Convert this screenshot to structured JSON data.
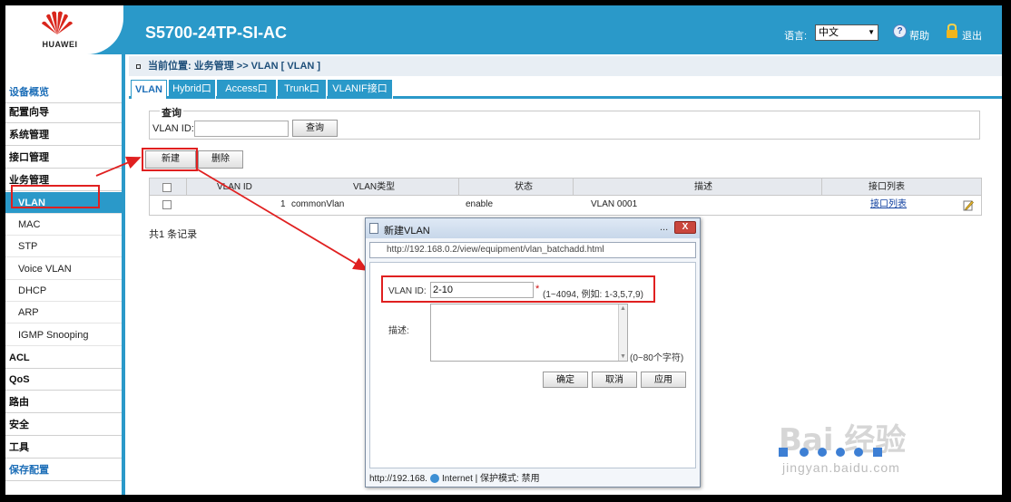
{
  "header": {
    "logo_text": "HUAWEI",
    "device_title": "S5700-24TP-SI-AC",
    "lang_label": "语言:",
    "lang_value": "中文",
    "help_label": "帮助",
    "logout_label": "退出"
  },
  "sidebar": {
    "items": [
      {
        "label": "设备概览",
        "blue": true
      },
      {
        "label": "配置向导"
      },
      {
        "label": "系统管理"
      },
      {
        "label": "接口管理"
      },
      {
        "label": "业务管理"
      }
    ],
    "subitems": [
      "VLAN",
      "MAC",
      "STP",
      "Voice VLAN",
      "DHCP",
      "ARP",
      "IGMP Snooping"
    ],
    "items_after": [
      "ACL",
      "QoS",
      "路由",
      "安全",
      "工具"
    ],
    "save_config": "保存配置"
  },
  "breadcrumb": "当前位置: 业务管理 >> VLAN [ VLAN ]",
  "tabs": [
    "VLAN",
    "Hybrid口",
    "Access口",
    "Trunk口",
    "VLANIF接口"
  ],
  "query": {
    "title": "查询",
    "vlan_id_label": "VLAN ID:",
    "vlan_id_value": "",
    "query_button": "查询"
  },
  "actions": {
    "new_button": "新建",
    "delete_button": "删除"
  },
  "table": {
    "headers": [
      "VLAN ID",
      "VLAN类型",
      "状态",
      "描述",
      "接口列表"
    ],
    "rows": [
      {
        "vlan_id": "1",
        "type": "commonVlan",
        "status": "enable",
        "desc": "VLAN 0001",
        "ports": "接口列表"
      }
    ],
    "record_count": "共1 条记录"
  },
  "dialog": {
    "title": "新建VLAN",
    "minimize": "...",
    "close": "X",
    "address": "http://192.168.0.2/view/equipment/vlan_batchadd.html",
    "vlan_id_label": "VLAN ID:",
    "vlan_id_value": "2-10",
    "required_mark": "*",
    "range_hint": "(1~4094, 例如: 1-3,5,7,9)",
    "desc_label": "描述:",
    "desc_value": "",
    "desc_hint": "(0~80个字符)",
    "ok_button": "确定",
    "cancel_button": "取消",
    "apply_button": "应用",
    "status_url": "http://192.168.",
    "status_zone": "Internet | 保护模式: 禁用"
  },
  "watermark": {
    "main": "Bai 经验",
    "url": "jingyan.baidu.com"
  },
  "colors": {
    "header_blue": "#2a99c9",
    "highlight_red": "#e02020",
    "link_blue": "#1040a0"
  }
}
